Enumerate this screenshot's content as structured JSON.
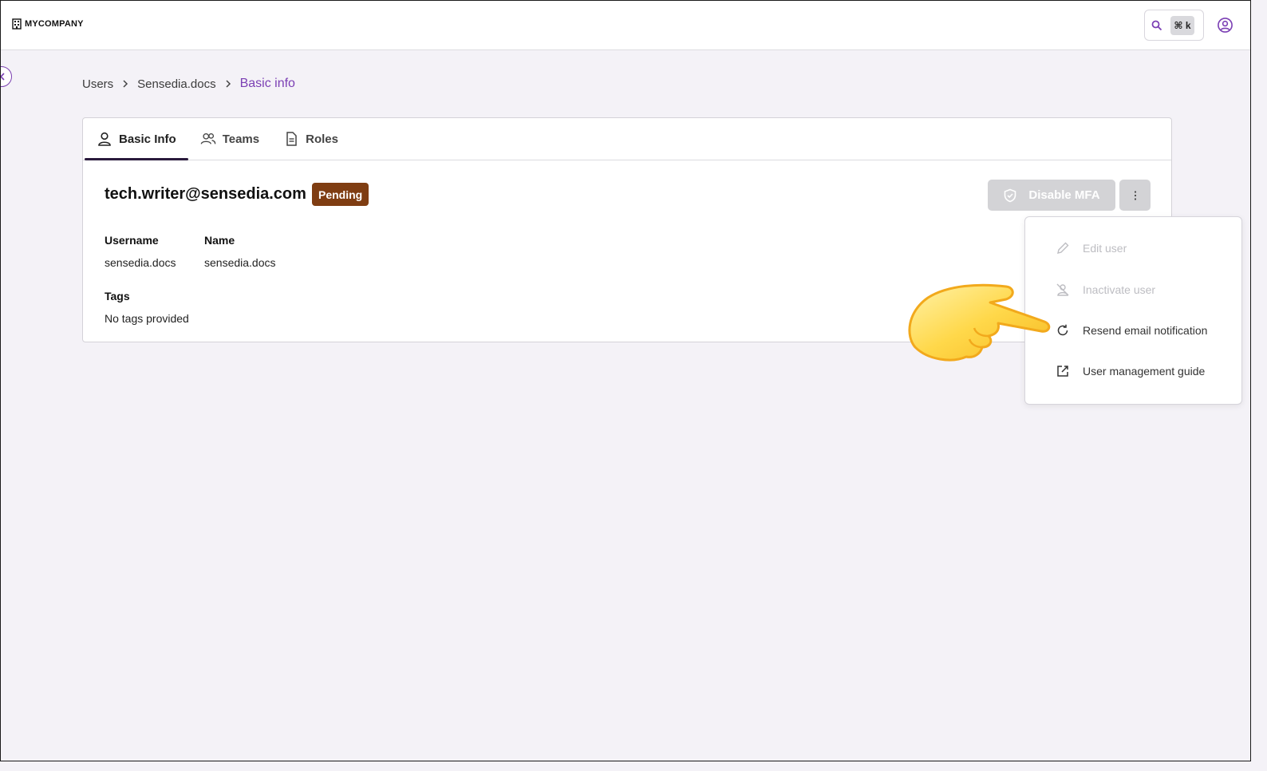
{
  "topbar": {
    "brand": "MYCOMPANY",
    "search_shortcut": "⌘ k"
  },
  "breadcrumb": {
    "items": [
      "Users",
      "Sensedia.docs"
    ],
    "current": "Basic info"
  },
  "tabs": [
    {
      "label": "Basic Info",
      "active": true
    },
    {
      "label": "Teams",
      "active": false
    },
    {
      "label": "Roles",
      "active": false
    }
  ],
  "user": {
    "email": "tech.writer@sensedia.com",
    "status": "Pending",
    "username_label": "Username",
    "username": "sensedia.docs",
    "name_label": "Name",
    "name": "sensedia.docs",
    "tags_label": "Tags",
    "tags": "No tags provided"
  },
  "actions": {
    "disable_mfa": "Disable MFA"
  },
  "menu": {
    "items": [
      {
        "label": "Edit user",
        "icon": "pencil-icon",
        "disabled": true
      },
      {
        "label": "Inactivate user",
        "icon": "user-off-icon",
        "disabled": true
      },
      {
        "label": "Resend email notification",
        "icon": "refresh-icon",
        "disabled": false
      },
      {
        "label": "User management guide",
        "icon": "external-link-icon",
        "disabled": false
      }
    ]
  },
  "colors": {
    "accent": "#7b3fb4",
    "badge_pending": "#7f3d12",
    "disabled_button": "#d3d3d6"
  }
}
